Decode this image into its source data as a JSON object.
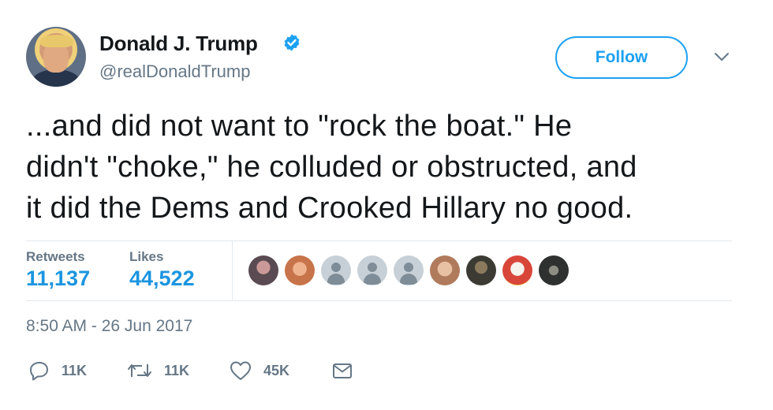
{
  "author": {
    "name": "Donald J. Trump",
    "handle": "@realDonaldTrump",
    "verified": true
  },
  "follow_label": "Follow",
  "tweet": {
    "text": "...and did not want to \"rock the boat.\" He\ndidn't \"choke,\" he colluded or obstructed, and\nit did the Dems and Crooked Hillary no good."
  },
  "stats": {
    "retweets_label": "Retweets",
    "retweets_value": "11,137",
    "likes_label": "Likes",
    "likes_value": "44,522"
  },
  "likers": [
    {
      "icon": "liker-photo-1",
      "color": "#5a4a52"
    },
    {
      "icon": "liker-photo-2",
      "color": "#c8744a"
    },
    {
      "icon": "default-avatar-icon",
      "color": "#c7d0d7"
    },
    {
      "icon": "default-avatar-icon",
      "color": "#c7d0d7"
    },
    {
      "icon": "default-avatar-icon",
      "color": "#c7d0d7"
    },
    {
      "icon": "liker-photo-3",
      "color": "#b07a5c"
    },
    {
      "icon": "liker-photo-4",
      "color": "#3b3a33"
    },
    {
      "icon": "liker-photo-5",
      "color": "#d8463a"
    },
    {
      "icon": "liker-photo-6",
      "color": "#2f3130"
    }
  ],
  "timestamp": "8:50 AM - 26 Jun 2017",
  "actions": {
    "reply_icon": "reply-icon",
    "reply_count": "11K",
    "retweet_icon": "retweet-icon",
    "retweet_count": "11K",
    "like_icon": "heart-icon",
    "like_count": "45K",
    "dm_icon": "envelope-icon"
  },
  "colors": {
    "accent": "#1da1f2",
    "stat_blue": "#1b95e0",
    "muted": "#657786",
    "text": "#14171a",
    "divider": "#e1e8ed"
  }
}
